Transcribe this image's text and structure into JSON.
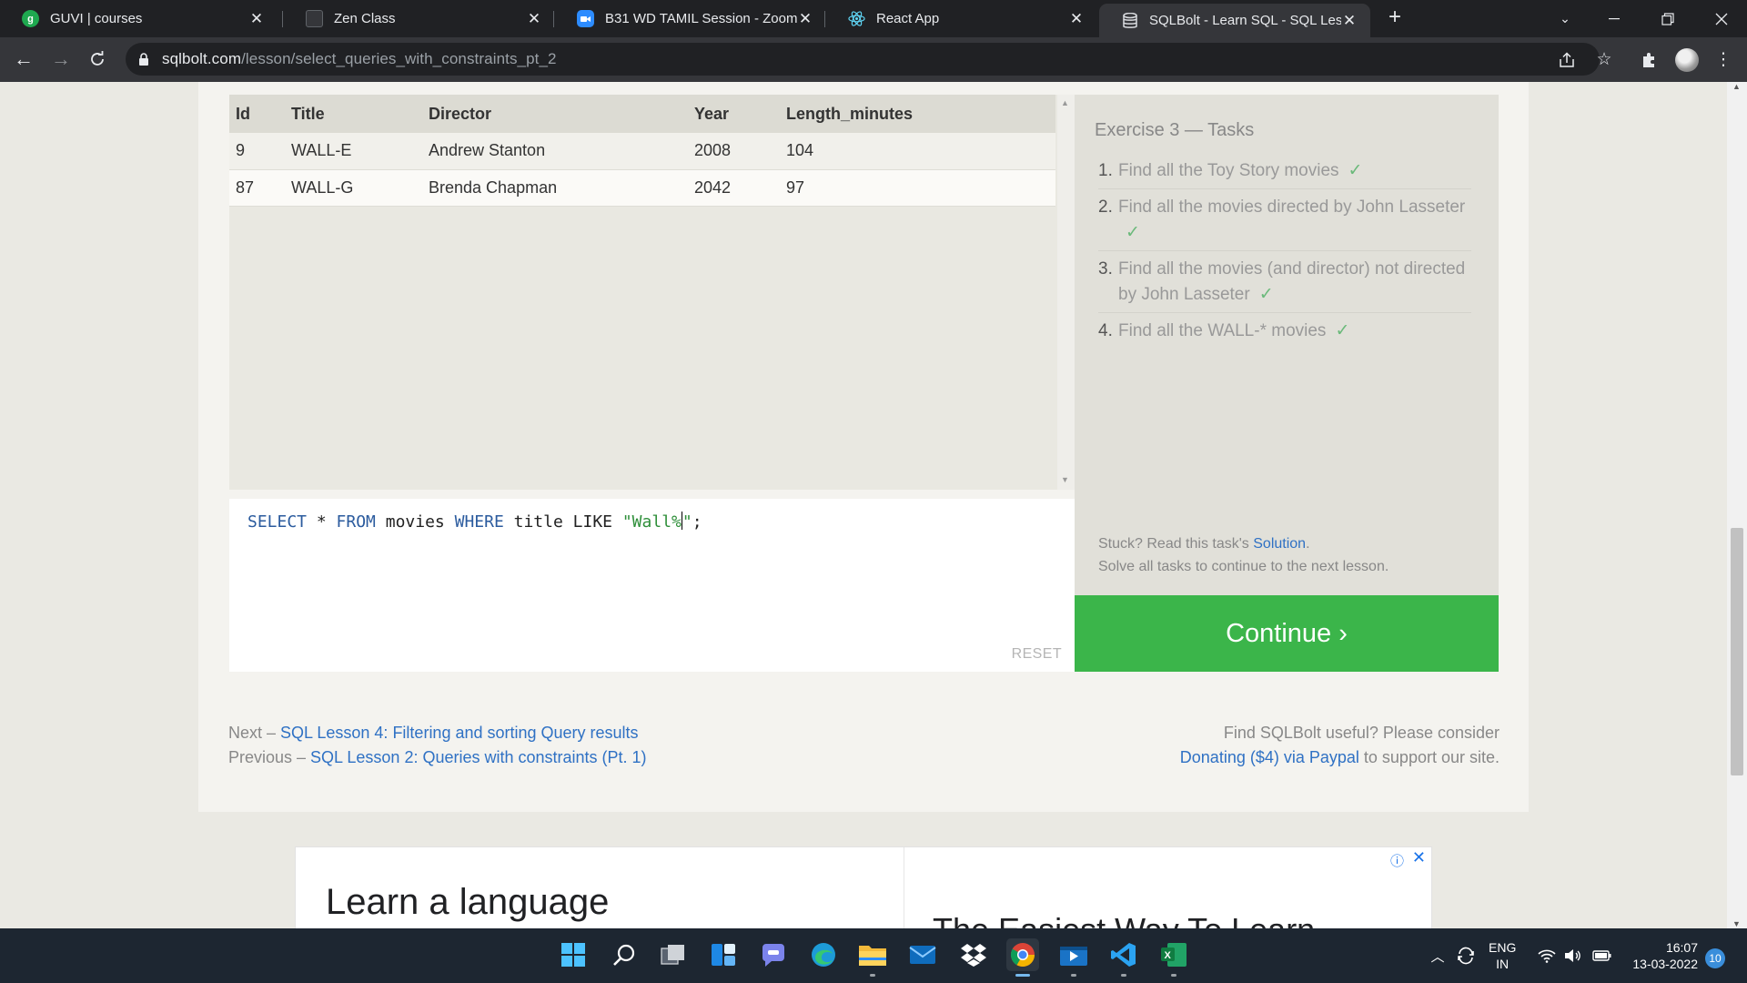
{
  "browser": {
    "tabs": [
      {
        "title": "GUVI | courses",
        "icon": "guvi-icon",
        "color": "#1fa950"
      },
      {
        "title": "Zen Class",
        "icon": "zen-class-icon",
        "color": "#35363a"
      },
      {
        "title": "B31 WD TAMIL Session - Zoom",
        "icon": "zoom-icon",
        "color": "#2d8cff"
      },
      {
        "title": "React App",
        "icon": "react-icon",
        "color": "#61dafb"
      },
      {
        "title": "SQLBolt - Learn SQL - SQL Lesson",
        "icon": "sqlbolt-icon",
        "color": "#dadce0"
      }
    ],
    "url_host": "sqlbolt.com",
    "url_path": "/lesson/select_queries_with_constraints_pt_2"
  },
  "results": {
    "columns": [
      "Id",
      "Title",
      "Director",
      "Year",
      "Length_minutes"
    ],
    "rows": [
      [
        "9",
        "WALL-E",
        "Andrew Stanton",
        "2008",
        "104"
      ],
      [
        "87",
        "WALL-G",
        "Brenda Chapman",
        "2042",
        "97"
      ]
    ]
  },
  "editor": {
    "query": {
      "kw1": "SELECT",
      "p1": " * ",
      "kw2": "FROM",
      "p2": " movies ",
      "kw3": "WHERE",
      "p3": " title LIKE ",
      "str": "\"Wall%",
      "str_end": "\"",
      "end": ";"
    },
    "reset_label": "RESET"
  },
  "tasks": {
    "title": "Exercise 3 — Tasks",
    "items": [
      {
        "num": "1.",
        "text": "Find all the Toy Story movies"
      },
      {
        "num": "2.",
        "text": "Find all the movies directed by John Lasseter"
      },
      {
        "num": "3.",
        "text": "Find all the movies (and director) not directed by John Lasseter"
      },
      {
        "num": "4.",
        "text": "Find all the WALL-* movies"
      }
    ],
    "check_mark": "✓",
    "stuck_prefix": "Stuck? Read this task's ",
    "solution_link": "Solution",
    "stuck_suffix": ".",
    "solve_all": "Solve all tasks to continue to the next lesson."
  },
  "continue_label": "Continue ›",
  "footer": {
    "next_prefix": "Next – ",
    "next_link": "SQL Lesson 4: Filtering and sorting Query results",
    "prev_prefix": "Previous – ",
    "prev_link": "SQL Lesson 2: Queries with constraints (Pt. 1)",
    "useful": "Find SQLBolt useful? Please consider",
    "donate_link": "Donating ($4) via Paypal",
    "donate_suffix": " to support our site."
  },
  "ad": {
    "headline": "Learn a language",
    "right_text": "The Easiest Way To Learn"
  },
  "taskbar": {
    "apps": [
      "windows-start-icon",
      "search-icon",
      "task-view-icon",
      "widgets-icon",
      "teams-chat-icon",
      "edge-icon",
      "file-explorer-icon",
      "mail-icon",
      "dropbox-icon",
      "chrome-icon",
      "media-player-icon",
      "vscode-icon",
      "excel-icon"
    ],
    "lang_line1": "ENG",
    "lang_line2": "IN",
    "time": "16:07",
    "date": "13-03-2022",
    "notifications": "10"
  }
}
